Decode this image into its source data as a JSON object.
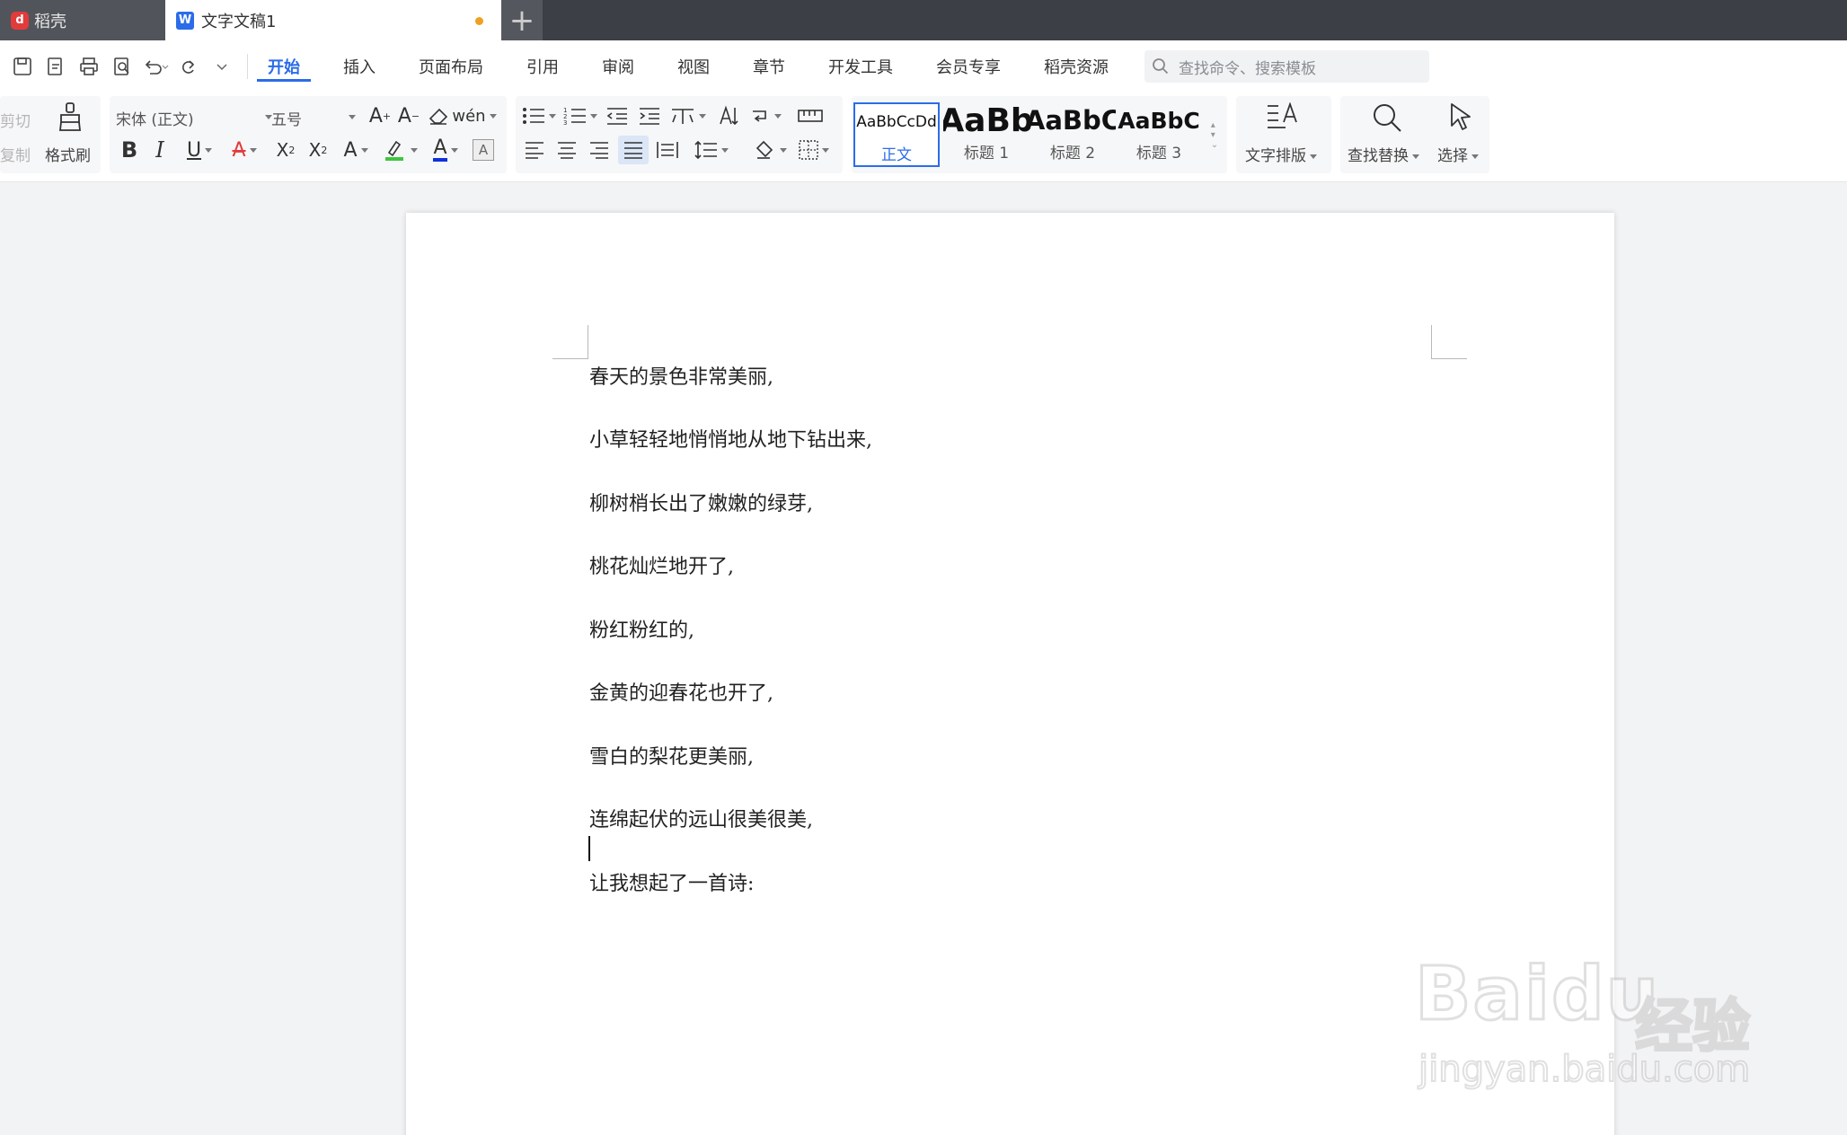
{
  "tabs": {
    "home_label": "稻壳",
    "doc_label": "文字文稿1",
    "new_tab_symbol": "+"
  },
  "menu": {
    "items": [
      "开始",
      "插入",
      "页面布局",
      "引用",
      "审阅",
      "视图",
      "章节",
      "开发工具",
      "会员专享",
      "稻壳资源"
    ],
    "active_index": 0,
    "search_placeholder": "查找命令、搜索模板"
  },
  "ribbon": {
    "clipboard": {
      "cut": "剪切",
      "copy": "复制",
      "format_painter": "格式刷"
    },
    "font": {
      "name": "宋体 (正文)",
      "size": "五号"
    },
    "styles": [
      {
        "sample": "AaBbCcDd",
        "label": "正文"
      },
      {
        "sample": "AaBb",
        "label": "标题 1"
      },
      {
        "sample": "AaBbC",
        "label": "标题 2"
      },
      {
        "sample": "AaBbC",
        "label": "标题 3"
      }
    ],
    "text_layout": "文字排版",
    "find_replace": "查找替换",
    "select": "选择"
  },
  "document": {
    "lines": [
      "春天的景色非常美丽,",
      "小草轻轻地悄悄地从地下钻出来,",
      "柳树梢长出了嫩嫩的绿芽,",
      "桃花灿烂地开了,",
      "粉红粉红的,",
      "金黄的迎春花也开了,",
      "雪白的梨花更美丽,",
      "连绵起伏的远山很美很美,",
      "让我想起了一首诗:"
    ]
  },
  "watermark": {
    "brand": "Baidu",
    "cn": "经验",
    "url": "jingyan.baidu.com"
  },
  "colors": {
    "accent": "#2b6ce8",
    "tabbar": "#3d3f46",
    "modified_dot": "#f0a020",
    "logo": "#e23b3b"
  }
}
